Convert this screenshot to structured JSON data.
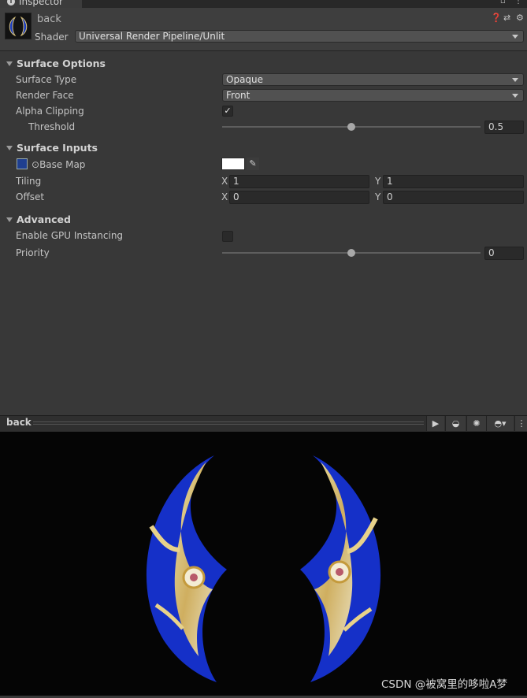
{
  "window": {
    "tab_title": "Inspector",
    "info_icon": "info-icon",
    "maximize_icon": "maximize-icon",
    "menu_icon": "kebab-menu-icon"
  },
  "material": {
    "name": "back",
    "shader_label": "Shader",
    "shader_value": "Universal Render Pipeline/Unlit",
    "header_icons": [
      "help-icon",
      "preset-icon",
      "settings-icon"
    ]
  },
  "surface_options": {
    "title": "Surface Options",
    "surface_type": {
      "label": "Surface Type",
      "value": "Opaque"
    },
    "render_face": {
      "label": "Render Face",
      "value": "Front"
    },
    "alpha_clipping": {
      "label": "Alpha Clipping",
      "checked": true
    },
    "threshold": {
      "label": "Threshold",
      "value": "0.5",
      "fraction": 0.5
    }
  },
  "surface_inputs": {
    "title": "Surface Inputs",
    "base_map": {
      "label": "Base Map",
      "prefix": "⊙",
      "color": "#ffffff"
    },
    "tiling": {
      "label": "Tiling",
      "x_axis": "X",
      "x": "1",
      "y_axis": "Y",
      "y": "1"
    },
    "offset": {
      "label": "Offset",
      "x_axis": "X",
      "x": "0",
      "y_axis": "Y",
      "y": "0"
    }
  },
  "advanced": {
    "title": "Advanced",
    "gpu_instancing": {
      "label": "Enable GPU Instancing",
      "checked": false
    },
    "priority": {
      "label": "Priority",
      "value": "0",
      "fraction": 0.5
    }
  },
  "preview": {
    "title": "back",
    "buttons": [
      "play-icon",
      "sphere-mesh-icon",
      "lighting-icon",
      "preview-shape-icon",
      "kebab-menu-icon"
    ]
  },
  "watermark": "CSDN @被窝里的哆啦A梦"
}
